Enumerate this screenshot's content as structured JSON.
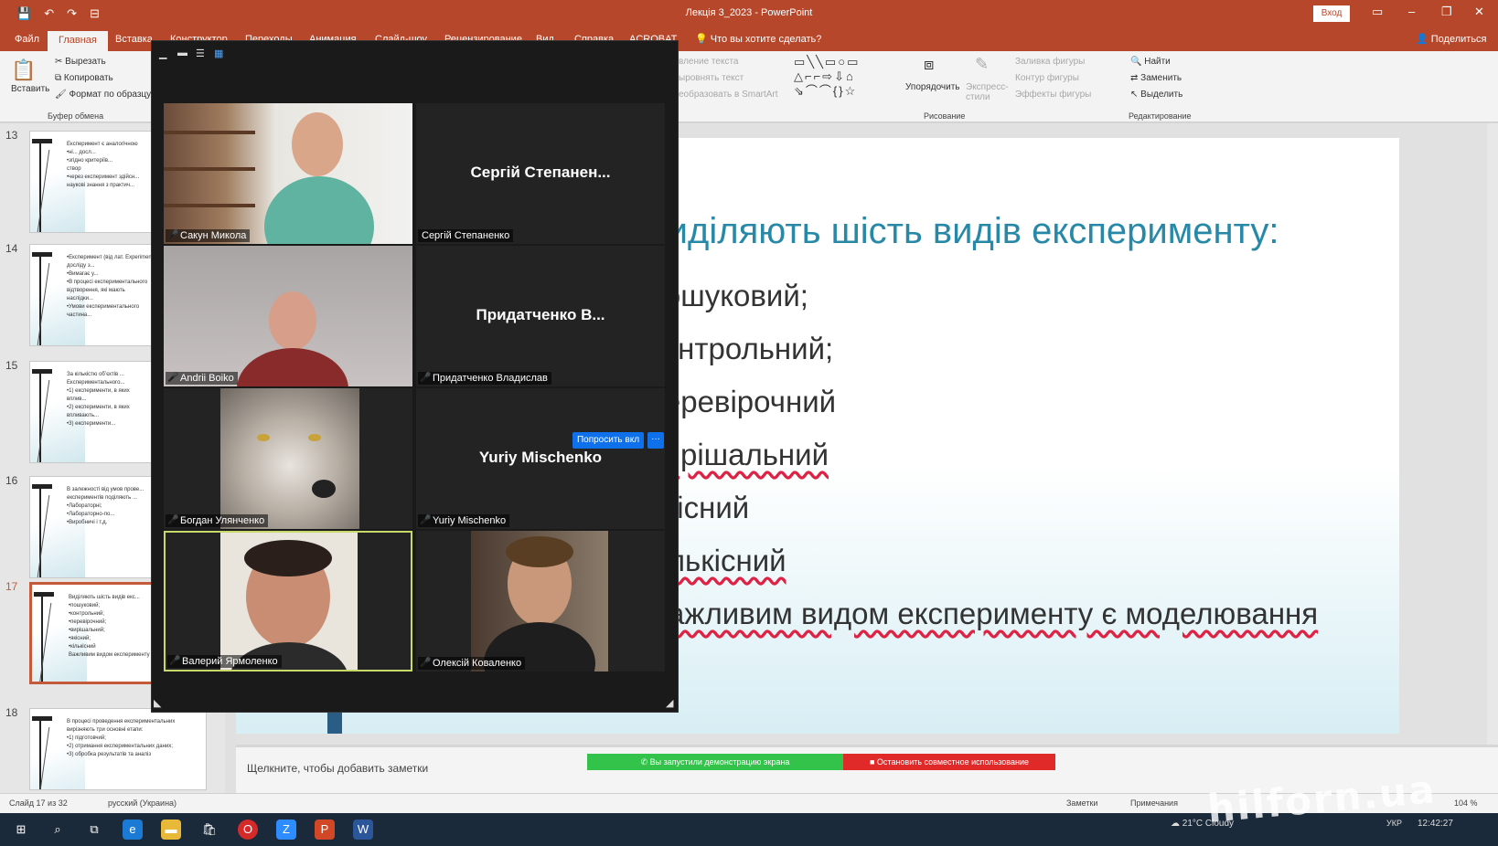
{
  "titlebar": {
    "doc_title": "Лекція 3_2023 - PowerPoint",
    "signin": "Вход",
    "quick_access": [
      "💾",
      "↶",
      "↷",
      "⊟"
    ]
  },
  "ribbon_tabs": [
    "Файл",
    "Главная",
    "Вставка",
    "Конструктор",
    "Переходы",
    "Анимация",
    "Слайд-шоу",
    "Рецензирование",
    "Вид",
    "Справка",
    "ACROBAT"
  ],
  "tell_me": "Что вы хотите сделать?",
  "share": "Поделиться",
  "ribbon": {
    "paste": "Вставить",
    "cut": "Вырезать",
    "copy": "Копировать",
    "format_painter": "Формат по образцу",
    "clipboard_group": "Буфер обмена",
    "text_direction": "вление текста",
    "align_text": "ыровнять текст",
    "smartart": "еобразовать в SmartArt",
    "arrange": "Упорядочить",
    "quick_styles": "Экспресс-стили",
    "shape_fill": "Заливка фигуры",
    "shape_outline": "Контур фигуры",
    "shape_effects": "Эффекты фигуры",
    "drawing_group": "Рисование",
    "find": "Найти",
    "replace": "Заменить",
    "select": "Выделить",
    "editing_group": "Редактирование"
  },
  "thumbnails": [
    {
      "num": "13",
      "text": "Експеримент є аналогічною\n•ні... досл...\n•згідно критеріїв...\nствор\n•через експеримент здійсн...\nнаукові знання з практич..."
    },
    {
      "num": "14",
      "text": "•Експеримент (від лат. Experimentum)...\nдосліду з...\n•Вимагає у...\n•В процесі експериментального\nвідтворення, які мають\nнаслідки...\n•Умови експериментального\nчастина..."
    },
    {
      "num": "15",
      "text": "За кількістю обʼєктів ...\nЕкспериментального...\n•1) експерименти, в яких\nвплив...\n•2) експерименти, в яких\nвпливають...\n•3) експерименти..."
    },
    {
      "num": "16",
      "text": "В залежності від умов прове...\nекспериментів поділяють ...\n•Лабораторні;\n•Лабораторно-по...\n•Виробничі і т.д."
    },
    {
      "num": "17",
      "text": "Виділяють шість видів екс...\n•пошуковий;\n•контрольний;\n•перевірочний;\n•вирішальний;\n•якісний;\n•кількісний\nВажливим видом експерименту є моде..."
    },
    {
      "num": "18",
      "text": "В процесі проведення експериментальних\nвирізняють три основні етапи:\n•1) підготовчий;\n•2) отримання експериментальних даних;\n•3) обробка результатів та аналіз"
    }
  ],
  "slide": {
    "title": "Виділяють шість видів експерименту:",
    "bullets": [
      "пошуковий;",
      "контрольний;",
      "перевірочний",
      "вирішальний",
      "якісний",
      "кількісний"
    ],
    "last_line": "Важливим видом експерименту є моделювання"
  },
  "notes_placeholder": "Щелкните, чтобы добавить заметки",
  "sharing": {
    "started": "Вы запустили демонстрацию экрана",
    "stop": "Остановить совместное использование"
  },
  "statusbar": {
    "slide": "Слайд 17 из 32",
    "language": "русский (Украина)",
    "notes": "Заметки",
    "comments": "Примечания",
    "zoom": "104 %"
  },
  "zoom": {
    "participants": [
      {
        "name": "Сакун Микола",
        "display": "",
        "video": true
      },
      {
        "name": "Сергій Степаненко",
        "display": "Сергій Степанен...",
        "video": false
      },
      {
        "name": "Andrii Boiko",
        "display": "",
        "video": true
      },
      {
        "name": "Придатченко Владислав",
        "display": "Придатченко В...",
        "video": false
      },
      {
        "name": "Богдан Улянченко",
        "display": "",
        "video": true
      },
      {
        "name": "Yuriy Mischenko",
        "display": "Yuriy Mischenko",
        "video": false
      },
      {
        "name": "Валерий Ярмоленко",
        "display": "",
        "video": true
      },
      {
        "name": "Олексій Коваленко",
        "display": "",
        "video": true
      }
    ],
    "ask_unmute": "Попросить вкл",
    "more": "···"
  },
  "taskbar": {
    "weather": "21°C Cloudy",
    "time": "12:42:27",
    "lang": "УКР"
  },
  "watermark": "hilforn.ua",
  "colors": {
    "accent": "#b7472a",
    "slide_title": "#2789a7",
    "zoom_bg": "#1a1a1a",
    "zoom_blue": "#0e71eb"
  }
}
